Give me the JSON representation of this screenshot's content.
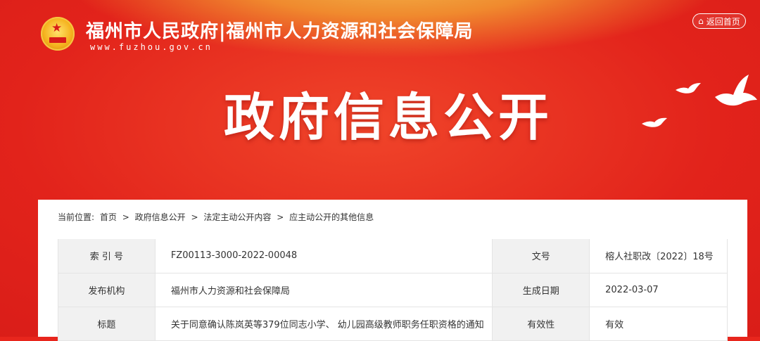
{
  "header": {
    "site_title": "福州市人民政府|福州市人力资源和社会保障局",
    "site_url": "www.fuzhou.gov.cn",
    "home_button": "返回首页",
    "page_heading": "政府信息公开"
  },
  "breadcrumb": {
    "label": "当前位置:",
    "items": [
      "首页",
      "政府信息公开",
      "法定主动公开内容",
      "应主动公开的其他信息"
    ],
    "separator": ">"
  },
  "info": {
    "index_label": "索 引 号",
    "index_value": "FZ00113-3000-2022-00048",
    "docno_label": "文号",
    "docno_value": "榕人社职改〔2022〕18号",
    "publisher_label": "发布机构",
    "publisher_value": "福州市人力资源和社会保障局",
    "date_label": "生成日期",
    "date_value": "2022-03-07",
    "title_label": "标题",
    "title_value": "关于同意确认陈岚英等379位同志小学、 幼儿园高级教师职务任职资格的通知",
    "validity_label": "有效性",
    "validity_value": "有效"
  },
  "colors": {
    "banner_red": "#e2231b",
    "banner_glow": "#f2b64a",
    "label_bg": "#f1f1f1"
  },
  "icons": [
    "national-emblem-icon",
    "home-icon",
    "dove-icon"
  ]
}
